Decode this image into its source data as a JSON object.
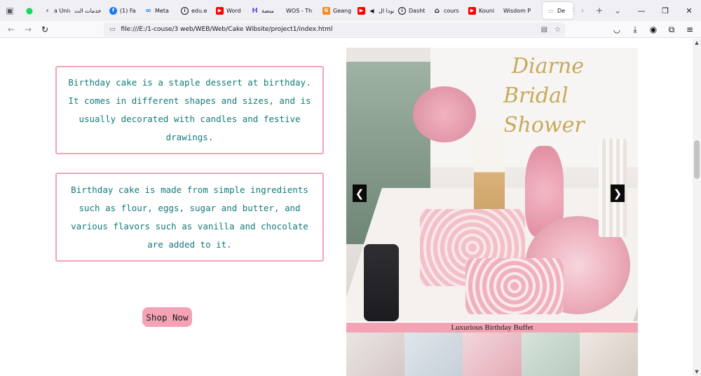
{
  "browser": {
    "tabs": [
      {
        "label": "a Univ",
        "icon": "chevron-left-icon",
        "color": "#5b5b66"
      },
      {
        "label": "خدمات الت",
        "icon": "none",
        "color": "#5b5b66"
      },
      {
        "label": "(1) Fa",
        "icon": "facebook-icon",
        "color": "#1877f2"
      },
      {
        "label": "Meta",
        "icon": "meta-icon",
        "color": "#0a7cff"
      },
      {
        "label": "edu.e",
        "icon": "info-icon",
        "color": "#15141a"
      },
      {
        "label": "Word",
        "icon": "youtube-icon",
        "color": "#ff0000"
      },
      {
        "label": "منصة",
        "icon": "h-logo-icon",
        "color": "#6b4ce6"
      },
      {
        "label": "WOS - Th",
        "icon": "none",
        "color": "#5b5b66"
      },
      {
        "label": "Geang",
        "icon": "geang-icon",
        "color": "#f08c2a"
      },
      {
        "label": "جودا ال",
        "icon": "youtube-icon",
        "color": "#ff0000"
      },
      {
        "label": "Dasht",
        "icon": "info-icon",
        "color": "#15141a"
      },
      {
        "label": "cours",
        "icon": "home-icon",
        "color": "#15141a"
      },
      {
        "label": "Kouni",
        "icon": "youtube-icon",
        "color": "#ff0000"
      },
      {
        "label": "Wisdom P",
        "icon": "none",
        "color": "#5b5b66"
      },
      {
        "label": "De",
        "icon": "page-icon",
        "color": "#9b9b9b"
      }
    ],
    "url": "file:///E:/1-couse/3 web/WEB/Web/Cake Wibsite/project1/index.html"
  },
  "content": {
    "box1_text": "Birthday cake is a staple dessert at birthday. It comes in different shapes and sizes, and is usually decorated with candles and festive drawings.",
    "box2_text": "Birthday cake is made from simple ingredients such as flour, eggs, sugar and butter, and various flavors such as vanilla and chocolate are added to it.",
    "shop_button": "Shop Now"
  },
  "carousel": {
    "sign_line1": "Diarne",
    "sign_line2": "Bridal Shower",
    "prev_arrow": "❮",
    "next_arrow": "❯",
    "caption": "Luxurious Birthday Buffet"
  },
  "colors": {
    "accent_pink": "#f4a3b4",
    "text_teal": "#127a7a"
  }
}
